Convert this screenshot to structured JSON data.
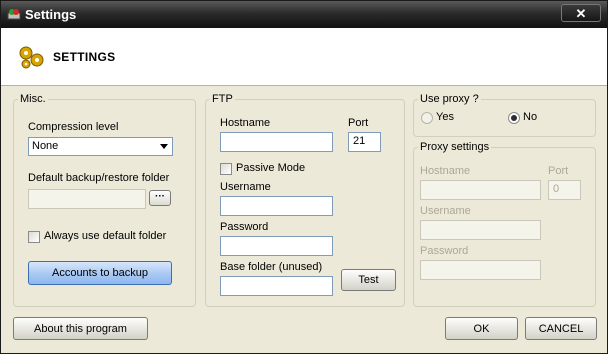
{
  "window": {
    "title": "Settings",
    "close_symbol": "✕"
  },
  "header": {
    "title": "SETTINGS"
  },
  "misc": {
    "legend": "Misc.",
    "compression_label": "Compression level",
    "compression_value": "None",
    "backup_folder_label": "Default backup/restore folder",
    "backup_folder_value": "",
    "browse_label": "···",
    "always_default_label": "Always use default folder",
    "accounts_button": "Accounts to backup"
  },
  "ftp": {
    "legend": "FTP",
    "hostname_label": "Hostname",
    "hostname_value": "",
    "port_label": "Port",
    "port_value": "21",
    "passive_label": "Passive Mode",
    "username_label": "Username",
    "username_value": "",
    "password_label": "Password",
    "password_value": "",
    "base_folder_label": "Base folder (unused)",
    "base_folder_value": "",
    "test_button": "Test"
  },
  "proxy": {
    "legend": "Use proxy ?",
    "yes_label": "Yes",
    "no_label": "No",
    "selected": "No"
  },
  "proxy_settings": {
    "legend": "Proxy settings",
    "hostname_label": "Hostname",
    "hostname_value": "",
    "port_label": "Port",
    "port_value": "0",
    "username_label": "Username",
    "username_value": "",
    "password_label": "Password",
    "password_value": ""
  },
  "footer": {
    "about_button": "About this program",
    "ok_button": "OK",
    "cancel_button": "CANCEL"
  }
}
